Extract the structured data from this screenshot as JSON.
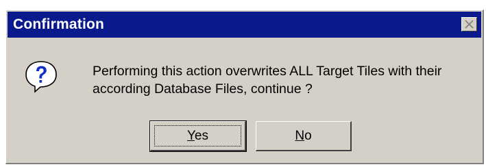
{
  "dialog": {
    "title": "Confirmation",
    "close_icon": "close-icon",
    "icon": "question-icon",
    "message_lines": [
      "Performing this action overwrites ALL Target Tiles with their",
      "according Database Files, continue ?"
    ],
    "buttons": {
      "yes": {
        "mnemonic": "Y",
        "rest": "es"
      },
      "no": {
        "mnemonic": "N",
        "rest": "o"
      }
    }
  },
  "colors": {
    "titlebar": "#0a1a8c",
    "dialog_bg": "#d4d0c8",
    "icon_blue": "#1030c8"
  }
}
